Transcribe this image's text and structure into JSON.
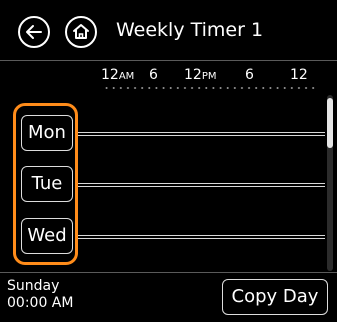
{
  "header": {
    "title": "Weekly Timer 1",
    "back_icon": "arrow-left-icon",
    "home_icon": "home-icon"
  },
  "timeline": {
    "labels": [
      {
        "value": "12",
        "suffix": "AM"
      },
      {
        "value": "6",
        "suffix": ""
      },
      {
        "value": "12",
        "suffix": "PM"
      },
      {
        "value": "6",
        "suffix": ""
      },
      {
        "value": "12",
        "suffix": ""
      }
    ]
  },
  "days": [
    {
      "label": "Mon"
    },
    {
      "label": "Tue"
    },
    {
      "label": "Wed"
    }
  ],
  "status": {
    "day": "Sunday",
    "time": "00:00 AM"
  },
  "actions": {
    "copy_day": "Copy Day"
  },
  "colors": {
    "background": "#000000",
    "foreground": "#ffffff",
    "highlight": "#ff8c1a"
  }
}
